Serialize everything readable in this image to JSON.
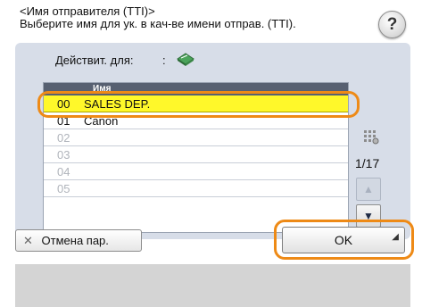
{
  "header": {
    "line1": "<Имя отправителя (TTI)>",
    "line2": "Выберите имя для ук. в кач-ве имени отправ. (TTI)."
  },
  "help": {
    "label": "?"
  },
  "action": {
    "label": "Действит. для:",
    "colon": ":",
    "icon": "address-book-icon"
  },
  "list": {
    "header": "Имя",
    "rows": [
      {
        "num": "00",
        "name": "SALES DEP.",
        "selected": true
      },
      {
        "num": "01",
        "name": "Canon"
      },
      {
        "num": "02",
        "name": ""
      },
      {
        "num": "03",
        "name": ""
      },
      {
        "num": "04",
        "name": ""
      },
      {
        "num": "05",
        "name": ""
      }
    ]
  },
  "pager": {
    "page": "1/17",
    "up_icon": "scroll-up-icon",
    "down_icon": "scroll-down-icon"
  },
  "buttons": {
    "cancel": "Отмена пар.",
    "ok": "OK"
  },
  "colors": {
    "highlight": "#ee8a16",
    "selected_row": "#fff82a",
    "panel": "#d7dde8"
  }
}
